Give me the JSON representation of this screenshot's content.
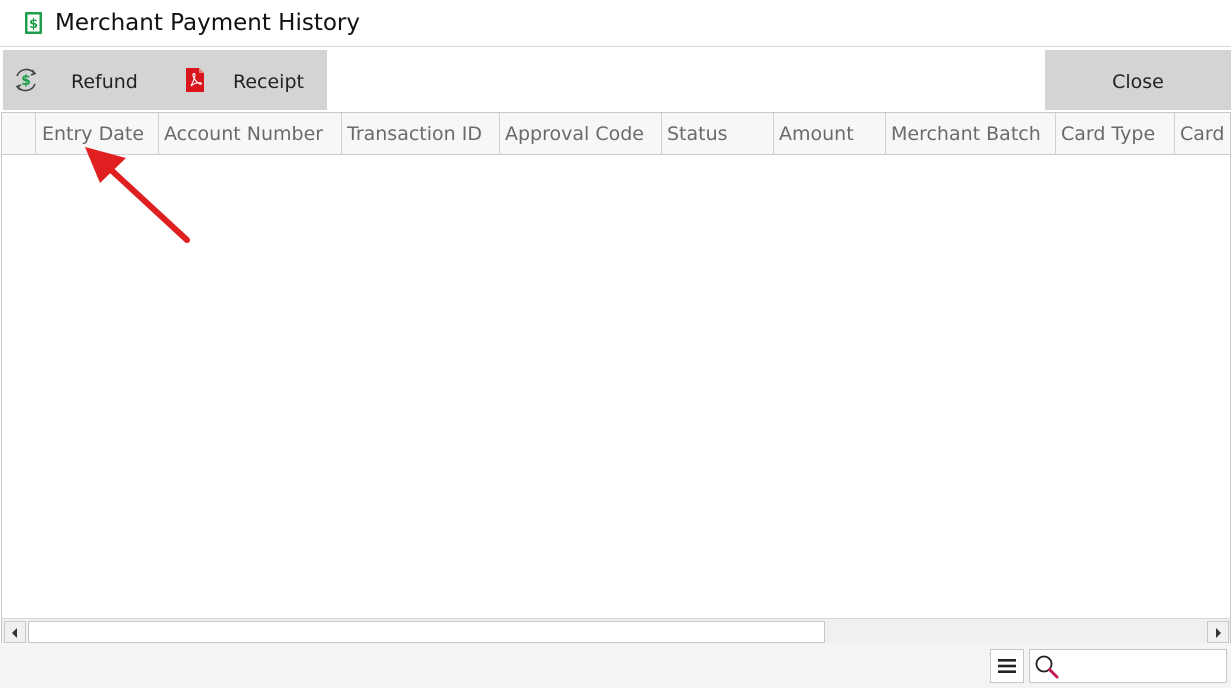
{
  "window": {
    "title": "Merchant Payment History",
    "title_icon": "dollar-bill-icon"
  },
  "toolbar": {
    "refund_label": "Refund",
    "refund_icon": "refund-cycle-icon",
    "receipt_label": "Receipt",
    "receipt_icon": "pdf-icon",
    "close_label": "Close"
  },
  "grid": {
    "columns": [
      {
        "label": "Entry Date"
      },
      {
        "label": "Account Number"
      },
      {
        "label": "Transaction ID"
      },
      {
        "label": "Approval Code"
      },
      {
        "label": "Status"
      },
      {
        "label": "Amount"
      },
      {
        "label": "Merchant Batch"
      },
      {
        "label": "Card Type"
      },
      {
        "label": "Card E"
      }
    ],
    "rows": []
  },
  "footer": {
    "menu_icon": "hamburger-menu-icon",
    "search_icon": "magnifier-icon",
    "search_value": ""
  },
  "annotation": {
    "arrow_color": "#e02020",
    "points_to": "Entry Date"
  },
  "colors": {
    "toolbar_button_bg": "#d4d4d4",
    "header_text": "#6a6a6a",
    "icon_green": "#1e9e4a",
    "pdf_red": "#d9161b"
  }
}
